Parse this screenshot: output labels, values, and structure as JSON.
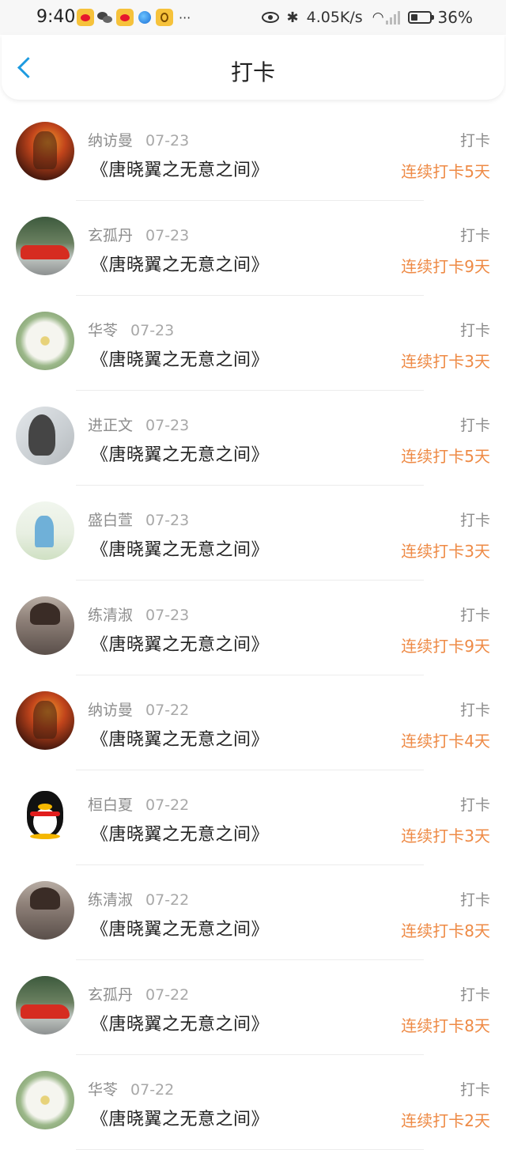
{
  "status_bar": {
    "time": "9:40",
    "app_icons": [
      "weibo-icon",
      "wechat-icon",
      "weibo-icon",
      "globe-icon",
      "app-icon"
    ],
    "more": "···",
    "bluetooth": "✱",
    "speed": "4.05K/s",
    "wifi": "◠",
    "battery": "36%"
  },
  "nav": {
    "back_icon": "chevron-left-icon",
    "title": "打卡"
  },
  "entries": [
    {
      "user": "纳访曼",
      "date": "07-23",
      "book": "《唐晓翼之无意之间》",
      "action": "打卡",
      "streak": "连续打卡5天",
      "avatar": "game"
    },
    {
      "user": "玄孤丹",
      "date": "07-23",
      "book": "《唐晓翼之无意之间》",
      "action": "打卡",
      "streak": "连续打卡9天",
      "avatar": "car"
    },
    {
      "user": "华苓",
      "date": "07-23",
      "book": "《唐晓翼之无意之间》",
      "action": "打卡",
      "streak": "连续打卡3天",
      "avatar": "flower"
    },
    {
      "user": "进正文",
      "date": "07-23",
      "book": "《唐晓翼之无意之间》",
      "action": "打卡",
      "streak": "连续打卡5天",
      "avatar": "girl"
    },
    {
      "user": "盛白萱",
      "date": "07-23",
      "book": "《唐晓翼之无意之间》",
      "action": "打卡",
      "streak": "连续打卡3天",
      "avatar": "cartoon"
    },
    {
      "user": "练清淑",
      "date": "07-23",
      "book": "《唐晓翼之无意之间》",
      "action": "打卡",
      "streak": "连续打卡9天",
      "avatar": "hat"
    },
    {
      "user": "纳访曼",
      "date": "07-22",
      "book": "《唐晓翼之无意之间》",
      "action": "打卡",
      "streak": "连续打卡4天",
      "avatar": "game"
    },
    {
      "user": "桓白夏",
      "date": "07-22",
      "book": "《唐晓翼之无意之间》",
      "action": "打卡",
      "streak": "连续打卡3天",
      "avatar": "qq"
    },
    {
      "user": "练清淑",
      "date": "07-22",
      "book": "《唐晓翼之无意之间》",
      "action": "打卡",
      "streak": "连续打卡8天",
      "avatar": "hat"
    },
    {
      "user": "玄孤丹",
      "date": "07-22",
      "book": "《唐晓翼之无意之间》",
      "action": "打卡",
      "streak": "连续打卡8天",
      "avatar": "car"
    },
    {
      "user": "华苓",
      "date": "07-22",
      "book": "《唐晓翼之无意之间》",
      "action": "打卡",
      "streak": "连续打卡2天",
      "avatar": "flower"
    }
  ],
  "colors": {
    "accent_blue": "#1e9be0",
    "streak_orange": "#ee8a45",
    "muted_text": "#8d8d8d"
  }
}
